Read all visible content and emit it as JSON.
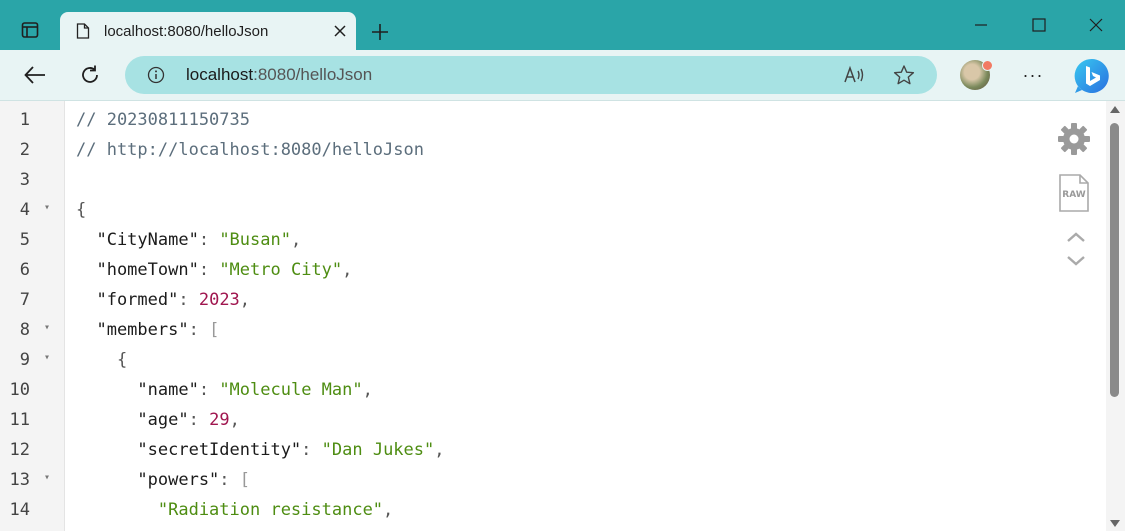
{
  "tab": {
    "title": "localhost:8080/helloJson"
  },
  "address": {
    "host": "localhost",
    "path": ":8080/helloJson"
  },
  "icons": {
    "tab_toggle": "tab-actions-icon",
    "page": "page-icon",
    "close": "close-icon",
    "new_tab": "plus-icon",
    "back": "back-arrow-icon",
    "refresh": "refresh-icon",
    "info": "info-icon",
    "read_aloud": "read-aloud-icon",
    "favorite": "star-icon",
    "more": "more-icon",
    "bing": "bing-icon",
    "settings": "gear-icon",
    "raw": "raw-file-icon",
    "collapse": "chevron-up-icon",
    "expand": "chevron-down-icon"
  },
  "more_label": "···",
  "raw_label": "RAW",
  "code_lines": [
    {
      "n": "1",
      "fold": "",
      "tokens": [
        {
          "t": "// 20230811150735",
          "c": "c-comment"
        }
      ]
    },
    {
      "n": "2",
      "fold": "",
      "tokens": [
        {
          "t": "// http://localhost:8080/helloJson",
          "c": "c-comment"
        }
      ]
    },
    {
      "n": "3",
      "fold": "",
      "tokens": []
    },
    {
      "n": "4",
      "fold": "▾",
      "tokens": [
        {
          "t": "{",
          "c": "c-punc"
        }
      ]
    },
    {
      "n": "5",
      "fold": "",
      "tokens": [
        {
          "t": "  \"CityName\"",
          "c": "c-key"
        },
        {
          "t": ": ",
          "c": "c-punc"
        },
        {
          "t": "\"Busan\"",
          "c": "c-str"
        },
        {
          "t": ",",
          "c": "c-punc"
        }
      ]
    },
    {
      "n": "6",
      "fold": "",
      "tokens": [
        {
          "t": "  \"homeTown\"",
          "c": "c-key"
        },
        {
          "t": ": ",
          "c": "c-punc"
        },
        {
          "t": "\"Metro City\"",
          "c": "c-str"
        },
        {
          "t": ",",
          "c": "c-punc"
        }
      ]
    },
    {
      "n": "7",
      "fold": "",
      "tokens": [
        {
          "t": "  \"formed\"",
          "c": "c-key"
        },
        {
          "t": ": ",
          "c": "c-punc"
        },
        {
          "t": "2023",
          "c": "c-num"
        },
        {
          "t": ",",
          "c": "c-punc"
        }
      ]
    },
    {
      "n": "8",
      "fold": "▾",
      "tokens": [
        {
          "t": "  \"members\"",
          "c": "c-key"
        },
        {
          "t": ": ",
          "c": "c-punc"
        },
        {
          "t": "[",
          "c": "c-brack"
        }
      ]
    },
    {
      "n": "9",
      "fold": "▾",
      "tokens": [
        {
          "t": "    {",
          "c": "c-punc"
        }
      ]
    },
    {
      "n": "10",
      "fold": "",
      "tokens": [
        {
          "t": "      \"name\"",
          "c": "c-key"
        },
        {
          "t": ": ",
          "c": "c-punc"
        },
        {
          "t": "\"Molecule Man\"",
          "c": "c-str"
        },
        {
          "t": ",",
          "c": "c-punc"
        }
      ]
    },
    {
      "n": "11",
      "fold": "",
      "tokens": [
        {
          "t": "      \"age\"",
          "c": "c-key"
        },
        {
          "t": ": ",
          "c": "c-punc"
        },
        {
          "t": "29",
          "c": "c-num"
        },
        {
          "t": ",",
          "c": "c-punc"
        }
      ]
    },
    {
      "n": "12",
      "fold": "",
      "tokens": [
        {
          "t": "      \"secretIdentity\"",
          "c": "c-key"
        },
        {
          "t": ": ",
          "c": "c-punc"
        },
        {
          "t": "\"Dan Jukes\"",
          "c": "c-str"
        },
        {
          "t": ",",
          "c": "c-punc"
        }
      ]
    },
    {
      "n": "13",
      "fold": "▾",
      "tokens": [
        {
          "t": "      \"powers\"",
          "c": "c-key"
        },
        {
          "t": ": ",
          "c": "c-punc"
        },
        {
          "t": "[",
          "c": "c-brack"
        }
      ]
    },
    {
      "n": "14",
      "fold": "",
      "tokens": [
        {
          "t": "        \"Radiation resistance\"",
          "c": "c-str"
        },
        {
          "t": ",",
          "c": "c-punc"
        }
      ]
    }
  ]
}
